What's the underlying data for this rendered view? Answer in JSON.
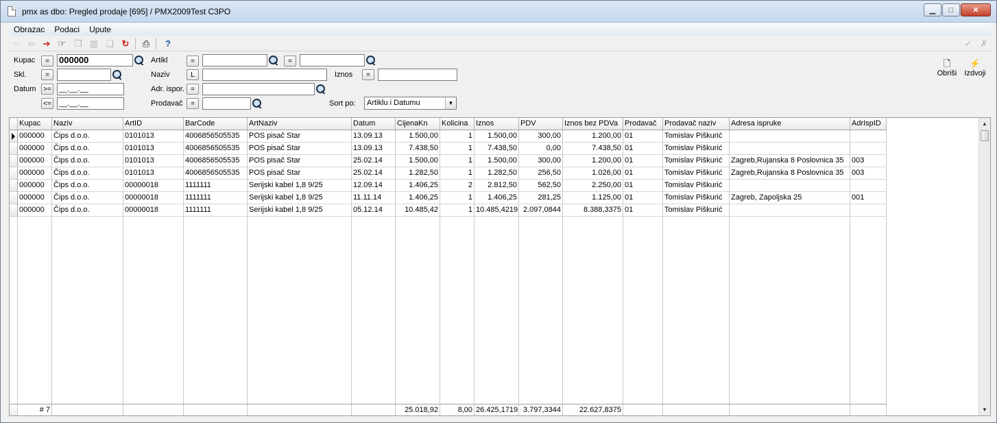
{
  "window": {
    "title": "pmx as dbo: Pregled prodaje [695] / PMX2009Test C3PO"
  },
  "menu": [
    "Obrazac",
    "Podaci",
    "Upute"
  ],
  "toolbar": {
    "icons": [
      "first-icon",
      "prev-icon",
      "next-icon",
      "goto-icon",
      "copy-icon",
      "delete-icon",
      "duplicate-icon",
      "refresh-icon",
      "print-icon",
      "help-icon",
      "confirm-icon",
      "cancel-icon"
    ]
  },
  "filter": {
    "kupac": {
      "label": "Kupac",
      "op": "=",
      "value": "000000"
    },
    "skl": {
      "label": "Skl.",
      "op": "=",
      "value": ""
    },
    "datum": {
      "label": "Datum",
      "op_from": ">=",
      "op_to": "<=",
      "from": "__.__.__",
      "to": "__.__.__"
    },
    "artikl": {
      "label": "Artikl",
      "op": "=",
      "value": "",
      "op2": "=",
      "value2": ""
    },
    "naziv": {
      "label": "Naziv",
      "op": "L",
      "value": ""
    },
    "adr_ispor": {
      "label": "Adr. ispor.",
      "op": "=",
      "value": ""
    },
    "prodavac": {
      "label": "Prodavač",
      "op": "=",
      "value": ""
    },
    "iznos": {
      "label": "Iznos",
      "op": "=",
      "value": ""
    },
    "sort": {
      "label": "Sort po:",
      "value": "Artiklu i Datumu"
    },
    "buttons": {
      "obrisi": "Obriši",
      "izdvoji": "Izdvoji"
    }
  },
  "grid": {
    "columns": [
      "Kupac",
      "Naziv",
      "ArtID",
      "BarCode",
      "ArtNaziv",
      "Datum",
      "CijenaKn",
      "Kolicina",
      "Iznos",
      "PDV",
      "Iznos bez PDVa",
      "Prodavač",
      "Prodavač naziv",
      "Adresa ispruke",
      "AdrIspID"
    ],
    "rows": [
      [
        "000000",
        "Čips d.o.o.",
        "0101013",
        "4006856505535",
        "POS pisač Star",
        "13.09.13",
        "1.500,00",
        "1",
        "1.500,00",
        "300,00",
        "1.200,00",
        "01",
        "Tomislav Piškurić",
        "",
        ""
      ],
      [
        "000000",
        "Čips d.o.o.",
        "0101013",
        "4006856505535",
        "POS pisač Star",
        "13.09.13",
        "7.438,50",
        "1",
        "7.438,50",
        "0,00",
        "7.438,50",
        "01",
        "Tomislav Piškurić",
        "",
        ""
      ],
      [
        "000000",
        "Čips d.o.o.",
        "0101013",
        "4006856505535",
        "POS pisač Star",
        "25.02.14",
        "1.500,00",
        "1",
        "1.500,00",
        "300,00",
        "1.200,00",
        "01",
        "Tomislav Piškurić",
        "Zagreb,Rujanska 8 Poslovnica 35",
        "003"
      ],
      [
        "000000",
        "Čips d.o.o.",
        "0101013",
        "4006856505535",
        "POS pisač Star",
        "25.02.14",
        "1.282,50",
        "1",
        "1.282,50",
        "256,50",
        "1.026,00",
        "01",
        "Tomislav Piškurić",
        "Zagreb,Rujanska 8 Poslovnica 35",
        "003"
      ],
      [
        "000000",
        "Čips d.o.o.",
        "00000018",
        "1111111",
        "Serijski kabel 1,8 9/25",
        "12.09.14",
        "1.406,25",
        "2",
        "2.812,50",
        "562,50",
        "2.250,00",
        "01",
        "Tomislav Piškurić",
        "",
        ""
      ],
      [
        "000000",
        "Čips d.o.o.",
        "00000018",
        "1111111",
        "Serijski kabel 1,8 9/25",
        "11.11.14",
        "1.406,25",
        "1",
        "1.406,25",
        "281,25",
        "1.125,00",
        "01",
        "Tomislav Piškurić",
        "Zagreb, Zapoljska 25",
        "001"
      ],
      [
        "000000",
        "Čips d.o.o.",
        "00000018",
        "1111111",
        "Serijski kabel 1,8 9/25",
        "05.12.14",
        "10.485,42",
        "1",
        "10.485,4219",
        "2.097,0844",
        "8.388,3375",
        "01",
        "Tomislav Piškurić",
        "",
        ""
      ]
    ],
    "footer": [
      "# 7",
      "",
      "",
      "",
      "",
      "",
      "25.018,92",
      "8,00",
      "26.425,1719",
      "3.797,3344",
      "22.627,8375",
      "",
      "",
      "",
      ""
    ]
  }
}
